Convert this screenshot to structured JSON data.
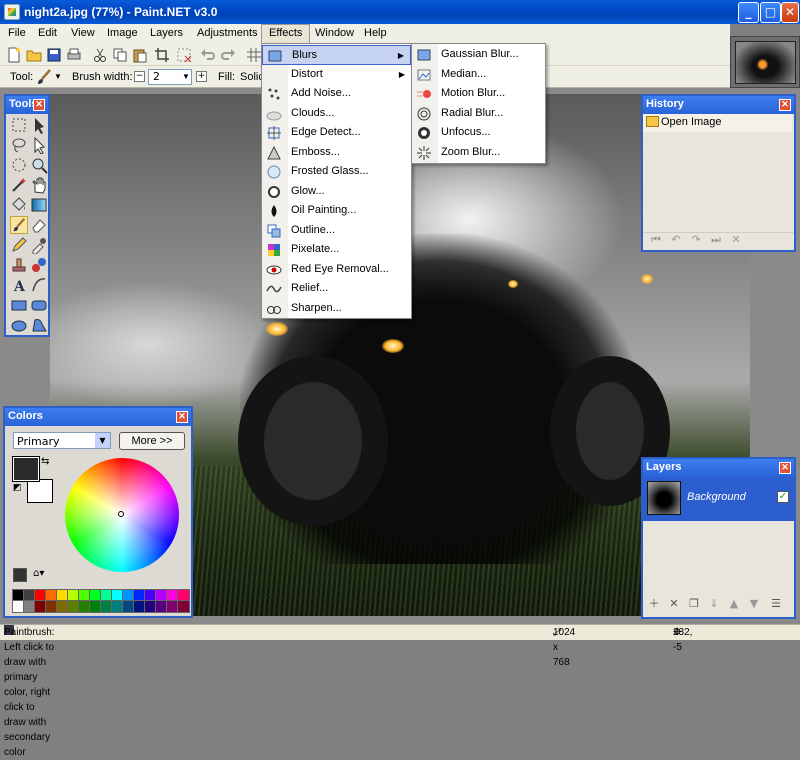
{
  "window": {
    "title": "night2a.jpg (77%) - Paint.NET v3.0"
  },
  "menubar": [
    "File",
    "Edit",
    "View",
    "Image",
    "Layers",
    "Adjustments",
    "Effects",
    "Window",
    "Help"
  ],
  "toolbar": {
    "tool_label": "Tool:",
    "brush_width_label": "Brush width:",
    "brush_width_value": "2",
    "fill_label": "Fill:",
    "fill_value": "Solic"
  },
  "effects_menu": [
    {
      "label": "Blurs",
      "icon": "blur-icon",
      "submenu": true
    },
    {
      "label": "Distort",
      "icon": "",
      "submenu": true
    },
    {
      "label": "Add Noise...",
      "icon": "noise-icon"
    },
    {
      "label": "Clouds...",
      "icon": "clouds-icon"
    },
    {
      "label": "Edge Detect...",
      "icon": "edge-detect-icon"
    },
    {
      "label": "Emboss...",
      "icon": "emboss-icon"
    },
    {
      "label": "Frosted Glass...",
      "icon": "frosted-glass-icon"
    },
    {
      "label": "Glow...",
      "icon": "glow-icon"
    },
    {
      "label": "Oil Painting...",
      "icon": "oil-painting-icon"
    },
    {
      "label": "Outline...",
      "icon": "outline-icon"
    },
    {
      "label": "Pixelate...",
      "icon": "pixelate-icon"
    },
    {
      "label": "Red Eye Removal...",
      "icon": "red-eye-icon"
    },
    {
      "label": "Relief...",
      "icon": "relief-icon"
    },
    {
      "label": "Sharpen...",
      "icon": "sharpen-icon"
    }
  ],
  "blurs_submenu": [
    {
      "label": "Gaussian Blur...",
      "icon": "gaussian-blur-icon"
    },
    {
      "label": "Median...",
      "icon": "median-icon"
    },
    {
      "label": "Motion Blur...",
      "icon": "motion-blur-icon"
    },
    {
      "label": "Radial Blur...",
      "icon": "radial-blur-icon"
    },
    {
      "label": "Unfocus...",
      "icon": "unfocus-icon"
    },
    {
      "label": "Zoom Blur...",
      "icon": "zoom-blur-icon"
    }
  ],
  "tools_panel": {
    "title": "Tools"
  },
  "history_panel": {
    "title": "History",
    "items": [
      "Open Image"
    ]
  },
  "layers_panel": {
    "title": "Layers",
    "layers": [
      {
        "name": "Background",
        "visible": true
      }
    ]
  },
  "colors_panel": {
    "title": "Colors",
    "mode": "Primary",
    "more_button": "More >>"
  },
  "statusbar": {
    "hint": "Paintbrush: Left click to draw with primary color, right click to draw with secondary color",
    "image_size": "1024 x 768",
    "cursor_pos": "232, -5"
  },
  "palette_colors": [
    "#000000",
    "#404040",
    "#ff0000",
    "#ff6a00",
    "#ffd800",
    "#b6ff00",
    "#4cff00",
    "#00ff21",
    "#00ff90",
    "#00ffff",
    "#0094ff",
    "#0026ff",
    "#4800ff",
    "#b200ff",
    "#ff00dc",
    "#ff006e",
    "#ffffff",
    "#808080",
    "#7f0000",
    "#7f3300",
    "#7f6a00",
    "#5b7f00",
    "#267f00",
    "#007f0e",
    "#007f46",
    "#007f7f",
    "#004a7f",
    "#00137f",
    "#21007f",
    "#57007f",
    "#7f006e",
    "#7f0037"
  ]
}
